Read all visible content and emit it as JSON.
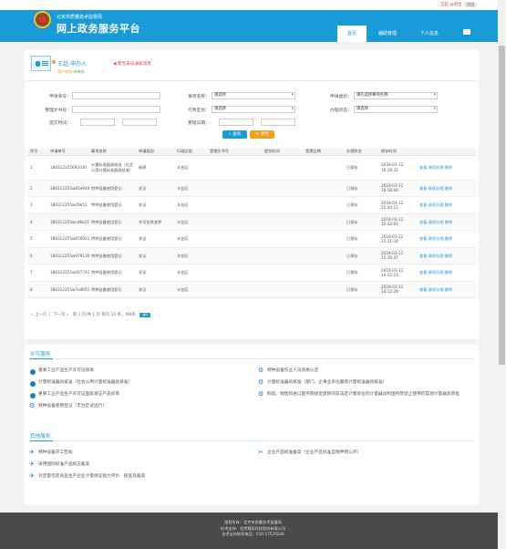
{
  "topbar": {
    "user": "王超 @退出",
    "exit": "退出"
  },
  "header": {
    "subtitle": "北京市质量技术监督局",
    "title": "网上政务服务平台",
    "nav": [
      "首页",
      "辅助管理",
      "个人信息"
    ]
  },
  "profile": {
    "name": "王超-申办人",
    "status_prefix": "用户状态:",
    "status": "待审核",
    "notice": "暂无未读通知消息"
  },
  "form": {
    "apply_no_label": "申请单号：",
    "accept_no_label": "受理文书号：",
    "submit_time_label": "提交时间：",
    "item_name_label": "事项名称：",
    "item_name_value": "请选择",
    "district_label": "行政区划：",
    "district_value": "请选择",
    "accept_date_label": "受理日期：",
    "apply_type_label": "申请类别：",
    "apply_type_value": "请先选择事项名称",
    "process_status_label": "办理状态：",
    "process_status_value": "请选择",
    "range_sep": "-",
    "search_btn": "查询",
    "reset_btn": "清空"
  },
  "table": {
    "headers": [
      "序号",
      "申请单号",
      "事项名称",
      "申请类别",
      "行政区划",
      "受理文书号",
      "提交时间",
      "受理日期",
      "办理状态",
      "保存时间",
      ""
    ],
    "rows": [
      {
        "no": "1",
        "id": "180312255692d30",
        "item": "计量标准器具核准（社会公用计量标准器具核准）",
        "type": "新建",
        "district": "丰台区",
        "status": "已保存",
        "time": "2018-03-12 16:19:32",
        "ops": "查看 继续办理 删除"
      },
      {
        "no": "2",
        "id": "180312255w05e940",
        "item": "特种设备使用登记",
        "type": "发证",
        "district": "丰台区",
        "status": "已保存",
        "time": "2018-03-12 16:18:40",
        "ops": "查看 继续办理 删除"
      },
      {
        "no": "3",
        "id": "180312255w26e51",
        "item": "特种设备使用登记",
        "type": "发证",
        "district": "丰台区",
        "status": "已保存",
        "time": "2018-03-12 15:44:11",
        "ops": "查看 继续办理 删除"
      },
      {
        "no": "4",
        "id": "180312255wcd8a21",
        "item": "特种设备使用登记",
        "type": "许可信息变更",
        "district": "丰台区",
        "status": "已保存",
        "time": "2018-03-12 15:32:01",
        "ops": "查看 继续办理 删除"
      },
      {
        "no": "5",
        "id": "180312255w656921",
        "item": "特种设备使用登记",
        "type": "发证",
        "district": "丰台区",
        "status": "已保存",
        "time": "2018-03-12 15:31:34",
        "ops": "查看 继续办理 删除"
      },
      {
        "no": "6",
        "id": "180312255w979130",
        "item": "特种设备使用登记",
        "type": "发证",
        "district": "丰台区",
        "status": "已保存",
        "time": "2018-03-12 15:30:47",
        "ops": "查看 继续办理 删除"
      },
      {
        "no": "7",
        "id": "180312255w457742",
        "item": "特种设备使用登记",
        "type": "发证",
        "district": "丰台区",
        "status": "已保存",
        "time": "2018-03-12 14:22:23",
        "ops": "查看 继续办理 删除"
      },
      {
        "no": "8",
        "id": "180312255w7ed051",
        "item": "特种设备使用登记",
        "type": "发证",
        "district": "丰台区",
        "status": "已保存",
        "time": "2018-03-12 14:12:29",
        "ops": "查看 继续办理 删除"
      }
    ]
  },
  "pager": {
    "prev": "« 上一页",
    "next": "下一页 »",
    "info": "第 1 页/共 1 页 每页 10 条，共8条",
    "go": "go"
  },
  "license": {
    "title": "许可服务",
    "left": [
      "重要工业产品生产许可证核发",
      "计量标准器具核准（社会公用计量标准器具核准）",
      "重要工业产品生产许可证国家发证产品初审",
      "特种设备使用登记（丰台区试运行）"
    ],
    "right": [
      "特种设备作业人员资格认定",
      "计量标准器具核准（部门、企事业单位最高计量标准器具核准）",
      "制造、销售和进口国务院规定废除的非法定计量单位的计量器具和国务院禁止使用的其他计量器具审批"
    ]
  },
  "other": {
    "title": "其他服务",
    "left": [
      "特种设备开工告知",
      "采用国际标准产品标志备案",
      "对定量包装商品生产企业计量保证能力评价、核查及备案"
    ],
    "right": [
      "企业产品标准备案（企业产品标准自我申明公开）"
    ]
  },
  "footer": {
    "line1": "版权所有：北京市质量技术监督局",
    "line2": "技术支持：北京慧辰科技股份有限公司",
    "line3": "技术支持联系电话：010-57520246"
  },
  "colors": {
    "primary": "#1a9ad6",
    "danger": "#e03b3b",
    "warning": "#f0a020",
    "success": "#52b152"
  }
}
